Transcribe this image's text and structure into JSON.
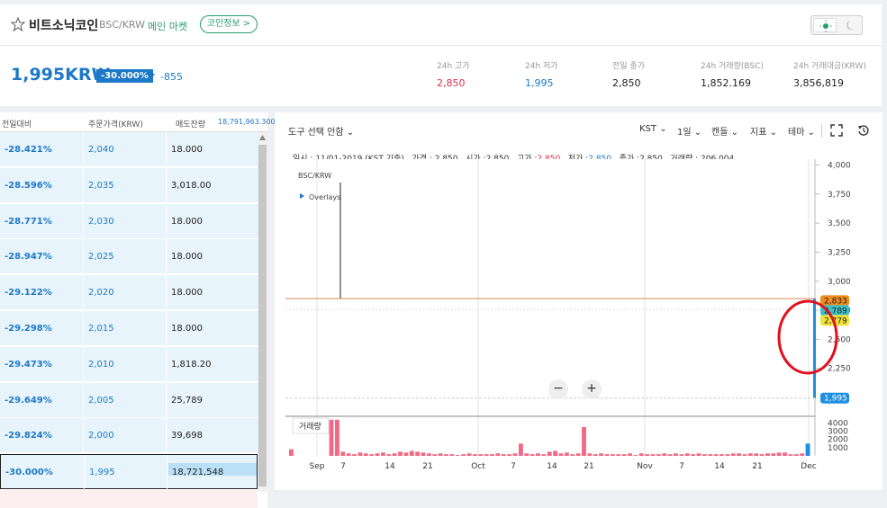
{
  "header": {
    "coin_name": "비트소닉코인",
    "pair": "BSC/KRW",
    "market": "메인 마켓",
    "info_button": "코인정보 >",
    "price": "1,995KRW",
    "change_percent": "-30.000%",
    "change_amount": "-855",
    "stats": [
      {
        "label": "24h 고가",
        "value": "2,850",
        "color": "#d9304f"
      },
      {
        "label": "24h 저가",
        "value": "1,995",
        "color": "#1e78c8"
      },
      {
        "label": "전일 종가",
        "value": "2,850",
        "color": "#222222"
      },
      {
        "label": "24h 거래량(BSC)",
        "value": "1,852.169",
        "color": "#222222"
      },
      {
        "label": "24h 거래대금(KRW)",
        "value": "3,856,819",
        "color": "#222222"
      }
    ]
  },
  "orderbook": {
    "headers": {
      "change": "전일대비",
      "price": "주문가격(KRW)",
      "qty": "매도잔량",
      "total": "18,791,963.300"
    },
    "rows": [
      {
        "change": "-28.421%",
        "price": "2,040",
        "qty": "18.000"
      },
      {
        "change": "-28.596%",
        "price": "2,035",
        "qty": "3,018.00"
      },
      {
        "change": "-28.771%",
        "price": "2,030",
        "qty": "18.000"
      },
      {
        "change": "-28.947%",
        "price": "2,025",
        "qty": "18.000"
      },
      {
        "change": "-29.122%",
        "price": "2,020",
        "qty": "18.000"
      },
      {
        "change": "-29.298%",
        "price": "2,015",
        "qty": "18.000"
      },
      {
        "change": "-29.473%",
        "price": "2,010",
        "qty": "1,818.20"
      },
      {
        "change": "-29.649%",
        "price": "2,005",
        "qty": "25,789"
      },
      {
        "change": "-29.824%",
        "price": "2,000",
        "qty": "39,698"
      },
      {
        "change": "-30.000%",
        "price": "1,995",
        "qty": "18,721,548"
      }
    ]
  },
  "chart_toolbar": {
    "tool_select": "도구 선택 안함",
    "timezone": "KST",
    "interval": "1일",
    "candle": "캔들",
    "indicator": "지표",
    "theme": "테마"
  },
  "chart_legend": {
    "date": "일시 : 11/01-2019 (KST 기준)",
    "price": "가격 : 2,850",
    "open_label": "시가 :",
    "open": "2,850",
    "high_label": "고가 :",
    "high": "2,850",
    "low_label": "저가 :",
    "low": "2,850",
    "close_label": "종가 :",
    "close": "2,850",
    "volume": "거래량 : 206.004"
  },
  "chart_data": {
    "type": "line",
    "pair_label": "BSC/KRW",
    "overlays_label": "Overlays",
    "volume_label": "거래량",
    "y_ticks": [
      "4,000",
      "3,750",
      "3,500",
      "3,250",
      "3,000",
      "2,750",
      "2,500",
      "2,250"
    ],
    "y_tick_values": [
      4000,
      3750,
      3500,
      3250,
      3000,
      2750,
      2500,
      2250
    ],
    "ylim": [
      1900,
      4050
    ],
    "price_level": 2850,
    "price_tags": [
      {
        "label": "2,833",
        "value": 2833,
        "color": "#f28a1e"
      },
      {
        "label": "2,789",
        "value": 2789,
        "color": "#3cc0c8"
      },
      {
        "label": "2,779",
        "value": 2779,
        "color": "#f2e23a"
      },
      {
        "label": "1,995",
        "value": 1995,
        "color": "#1e8fe0"
      }
    ],
    "x_ticks": [
      "Sep",
      "7",
      "14",
      "21",
      "Oct",
      "7",
      "14",
      "21",
      "Nov",
      "7",
      "14",
      "21",
      "Dec"
    ],
    "vol_ticks": [
      "4000",
      "3000",
      "2000",
      "1000"
    ],
    "vol_tick_values": [
      4000,
      3000,
      2000,
      1000
    ],
    "vol_max": 4600,
    "volumes": [
      800,
      0,
      0,
      0,
      0,
      0,
      0,
      4400,
      4400,
      500,
      300,
      200,
      400,
      300,
      200,
      300,
      400,
      200,
      300,
      500,
      400,
      600,
      500,
      400,
      300,
      200,
      300,
      200,
      200,
      100,
      200,
      300,
      200,
      200,
      200,
      200,
      300,
      200,
      200,
      300,
      1500,
      300,
      200,
      300,
      200,
      500,
      600,
      300,
      400,
      200,
      300,
      3500,
      300,
      200,
      300,
      200,
      200,
      200,
      200,
      300,
      100,
      300,
      200,
      200,
      200,
      300,
      200,
      300,
      200,
      300,
      200,
      300,
      200,
      200,
      200,
      200,
      200,
      300,
      300,
      200,
      300,
      300,
      200,
      300,
      300,
      400,
      400,
      200,
      200,
      300,
      1500
    ]
  }
}
